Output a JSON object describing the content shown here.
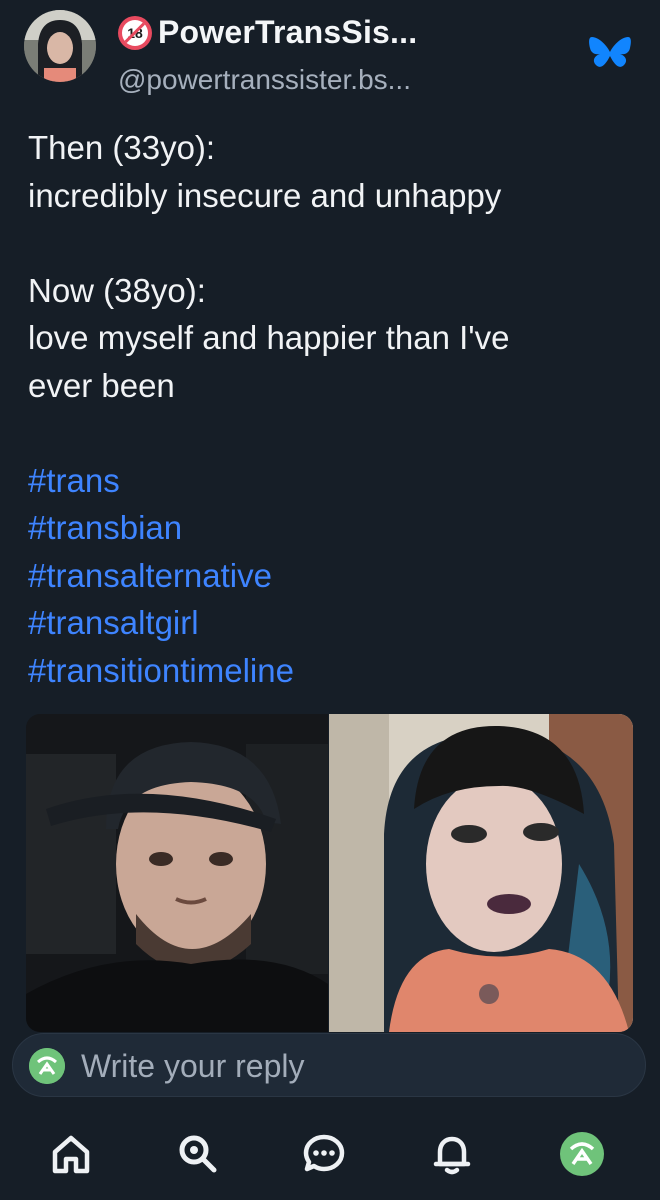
{
  "author": {
    "display_name": "PowerTransSis...",
    "handle": "@powertranssister.bs...",
    "badge": "18",
    "badge_icon": "adult-content-18-icon"
  },
  "post": {
    "lines": [
      {
        "text": "Then (33yo):",
        "type": "text"
      },
      {
        "text": "incredibly insecure and unhappy",
        "type": "text"
      },
      {
        "text": "",
        "type": "blank"
      },
      {
        "text": "Now (38yo):",
        "type": "text"
      },
      {
        "text": "love myself and happier than I've",
        "type": "text"
      },
      {
        "text": "ever been",
        "type": "text"
      },
      {
        "text": "",
        "type": "blank"
      },
      {
        "text": "#trans",
        "type": "hashtag"
      },
      {
        "text": "#transbian",
        "type": "hashtag"
      },
      {
        "text": "#transalternative",
        "type": "hashtag"
      },
      {
        "text": "#transaltgirl",
        "type": "hashtag"
      },
      {
        "text": "#transitiontimeline",
        "type": "hashtag"
      }
    ]
  },
  "media": {
    "images": [
      {
        "name": "then-photo",
        "description_icon": "photo"
      },
      {
        "name": "now-photo",
        "description_icon": "photo"
      }
    ]
  },
  "reply": {
    "placeholder": "Write your reply"
  },
  "tabs": [
    {
      "name": "home-icon"
    },
    {
      "name": "search-icon"
    },
    {
      "name": "chat-icon"
    },
    {
      "name": "notifications-icon"
    },
    {
      "name": "profile-avatar"
    }
  ],
  "colors": {
    "background": "#161e27",
    "hashtag": "#3e84ff",
    "bluesky": "#1185fe",
    "badge": "#e84a5f",
    "avatar_green": "#6fc37a"
  }
}
